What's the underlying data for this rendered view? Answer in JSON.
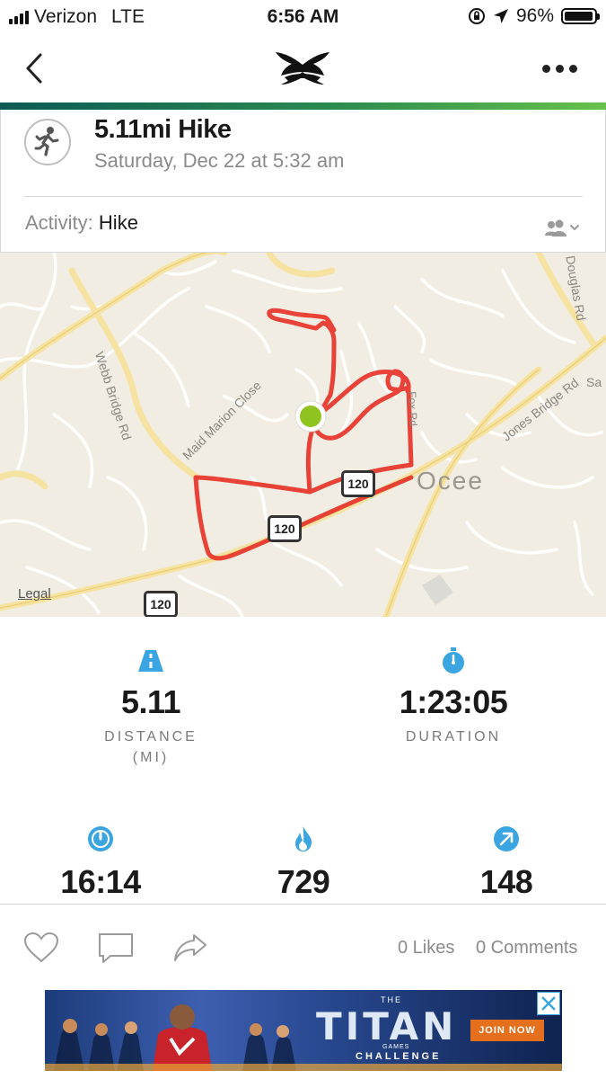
{
  "status_bar": {
    "carrier": "Verizon",
    "network": "LTE",
    "time": "6:56 AM",
    "battery": "96%",
    "battery_level": 0.96
  },
  "nav": {
    "back_icon": "chevron-left-icon",
    "logo_icon": "under-armour-logo",
    "more_icon": "more-dots-icon"
  },
  "workout": {
    "title": "5.11mi Hike",
    "date": "Saturday, Dec 22 at 5:32 am",
    "activity_label": "Activity:",
    "activity_value": "Hike",
    "privacy_icon": "people-icon"
  },
  "map": {
    "labels": {
      "webb": "Webb Bridge Rd",
      "maid": "Maid Marion Close",
      "douglas": "Douglas Rd",
      "jones": "Jones Bridge Rd",
      "sa": "Sa",
      "ocee": "Ocee",
      "fox": "Fox Rd",
      "legal": "Legal",
      "route1": "120",
      "route2": "120",
      "route3": "120"
    },
    "route_color": "#e8392f",
    "start_color": "#8fc31f"
  },
  "stats": {
    "distance": {
      "value": "5.11",
      "label": "DISTANCE",
      "unit": "(MI)"
    },
    "duration": {
      "value": "1:23:05",
      "label": "DURATION"
    },
    "pace": {
      "value": "16:14"
    },
    "calories": {
      "value": "729"
    },
    "elevation": {
      "value": "148"
    },
    "icon_color": "#3aa5e0"
  },
  "actions": {
    "likes": "0 Likes",
    "comments": "0 Comments"
  },
  "ad": {
    "brand_small": "THE",
    "brand": "TITAN",
    "brand_sub1": "GAMES",
    "brand_sub2": "CHALLENGE",
    "cta": "JOIN NOW"
  }
}
